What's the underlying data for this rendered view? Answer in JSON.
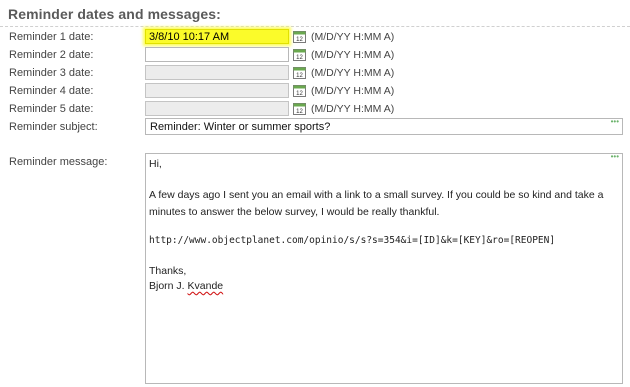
{
  "section": {
    "title": "Reminder dates and messages:"
  },
  "reminders": [
    {
      "label": "Reminder 1 date:",
      "value": "3/8/10 10:17 AM",
      "format_hint": "(M/D/YY H:MM A)"
    },
    {
      "label": "Reminder 2 date:",
      "value": "",
      "format_hint": "(M/D/YY H:MM A)"
    },
    {
      "label": "Reminder 3 date:",
      "value": "",
      "format_hint": "(M/D/YY H:MM A)"
    },
    {
      "label": "Reminder 4 date:",
      "value": "",
      "format_hint": "(M/D/YY H:MM A)"
    },
    {
      "label": "Reminder 5 date:",
      "value": "",
      "format_hint": "(M/D/YY H:MM A)"
    }
  ],
  "subject": {
    "label": "Reminder subject:",
    "value": "Reminder: Winter or summer sports?"
  },
  "message": {
    "label": "Reminder message:",
    "lines": [
      "Hi,",
      "A few days ago I sent you an email with a link to a small survey. If you could be so kind and take a",
      "minutes to answer the below survey, I would be really thankful.",
      "http://www.objectplanet.com/opinio/s/s?s=354&i=[ID]&k=[KEY]&ro=[REOPEN]",
      "Thanks,",
      "Bjorn J. ",
      "Kvande"
    ]
  },
  "icons": {
    "calendar": "calendar-icon",
    "resize": "resize-dots-icon"
  },
  "colors": {
    "highlight": "#fbfb2a",
    "disabled_field": "#ececec"
  }
}
